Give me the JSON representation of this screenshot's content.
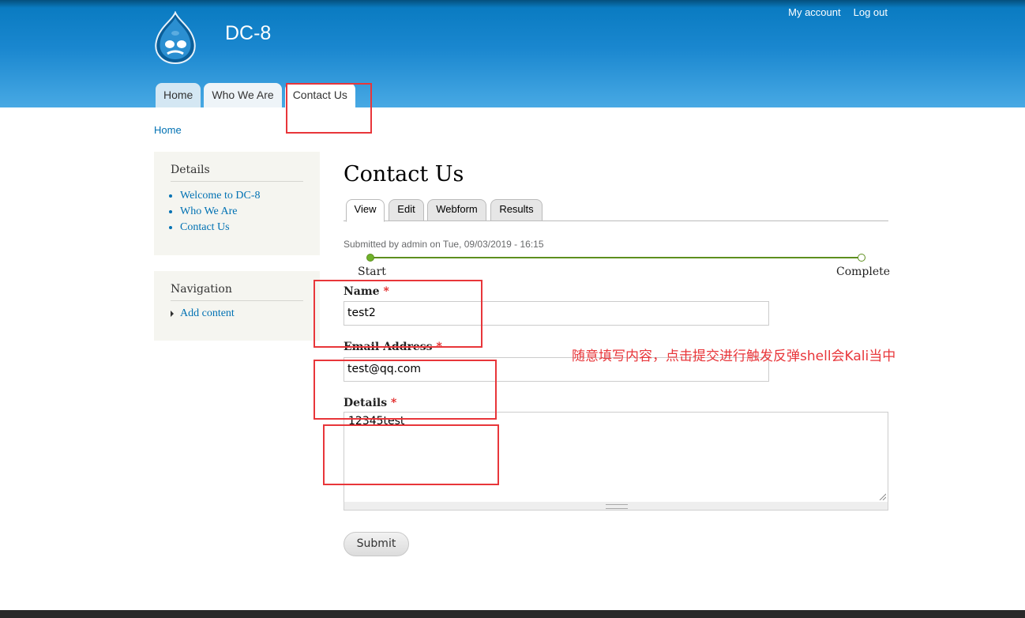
{
  "site": {
    "name": "DC-8",
    "secondary_menu": [
      "My account",
      "Log out"
    ],
    "main_menu": [
      "Home",
      "Who We Are",
      "Contact Us"
    ]
  },
  "breadcrumb": "Home",
  "sidebar": {
    "details": {
      "title": "Details",
      "items": [
        "Welcome to DC-8",
        "Who We Are",
        "Contact Us"
      ]
    },
    "navigation": {
      "title": "Navigation",
      "items": [
        "Add content"
      ]
    }
  },
  "page": {
    "title": "Contact Us",
    "tabs": [
      "View",
      "Edit",
      "Webform",
      "Results"
    ],
    "submitted": "Submitted by admin on Tue, 09/03/2019 - 16:15",
    "progress": {
      "start": "Start",
      "end": "Complete"
    }
  },
  "form": {
    "required_mark": "*",
    "name": {
      "label": "Name",
      "value": "test2"
    },
    "email": {
      "label": "Email Address",
      "value": "test@qq.com"
    },
    "details": {
      "label": "Details",
      "value": "12345test"
    },
    "submit_label": "Submit"
  },
  "annotation": {
    "text": "随意填写内容，点击提交进行触发反弹shell会Kali当中",
    "color": "#e8363a"
  },
  "colors": {
    "header_blue": "#1a87cf",
    "link": "#0071b3",
    "progress_green": "#5e8f1e"
  }
}
